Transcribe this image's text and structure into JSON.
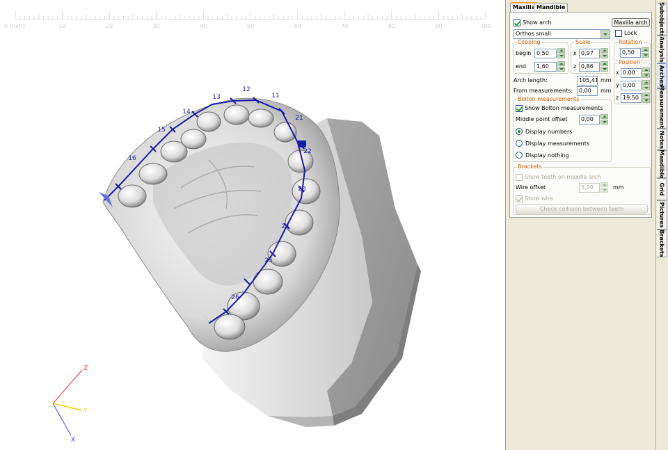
{
  "ruler": {
    "start_label": "0 [mm]",
    "labels": [
      "10",
      "20",
      "30",
      "40",
      "50",
      "60",
      "70",
      "80",
      "90",
      "100"
    ]
  },
  "tooth_numbers": [
    "16",
    "15",
    "14",
    "13",
    "12",
    "11",
    "21",
    "22",
    "23",
    "24",
    "25",
    "26"
  ],
  "axes": {
    "x": "X",
    "y": "Y",
    "z": "Z",
    "x_color": "#3344ff",
    "y_color": "#ffcc00",
    "z_color": "#ff3333"
  },
  "arch_color": "#1a1aa8",
  "tabs": {
    "maxilla": "Maxilla",
    "mandible": "Mandible"
  },
  "show_arch": {
    "label": "Show arch",
    "checked": true
  },
  "maxilla_arch_button": "Maxilla arch",
  "lock": {
    "label": "Lock",
    "checked": false
  },
  "arch_type": "Orthos small",
  "clipping": {
    "title": "Clipping",
    "begin_label": "begin",
    "begin_value": "0,50",
    "end_label": "end",
    "end_value": "1,60"
  },
  "scale": {
    "title": "Scale",
    "x_label": "x",
    "x_value": "0,97",
    "z_label": "z",
    "z_value": "0,86"
  },
  "rotation": {
    "title": "Rotation",
    "value": "0,50"
  },
  "position": {
    "title": "Position",
    "x_label": "x",
    "x_value": "0,00",
    "y_label": "y",
    "y_value": "0,00",
    "z_label": "z",
    "z_value": "19,50"
  },
  "arch_length": {
    "label": "Arch length:",
    "value": "105,41",
    "unit": "mm"
  },
  "from_measurements": {
    "label": "From measurements:",
    "value": "0,00",
    "unit": "mm"
  },
  "bolton": {
    "title": "Bolton measurements",
    "show_label": "Show Bolton measurements",
    "show_checked": true,
    "middle_label": "Middle point offset",
    "middle_value": "0,00",
    "display_numbers": "Display numbers",
    "display_measurements": "Display measurements",
    "display_nothing": "Display nothing",
    "selected": "numbers"
  },
  "brackets": {
    "title": "Brackets",
    "show_teeth_label": "Show teeth on maxilla arch",
    "wire_offset_label": "Wire offset",
    "wire_offset_value": "5,00",
    "wire_offset_unit": "mm",
    "show_wire_label": "Show wire",
    "collision_button": "Check collision between teeth"
  },
  "side_tabs": [
    "Subobjects",
    "Analysis",
    "Arches",
    "Measurements",
    "Notes",
    "Mandible",
    "Grid",
    "Pictures",
    "Brackets"
  ],
  "active_side_tab": "Arches"
}
